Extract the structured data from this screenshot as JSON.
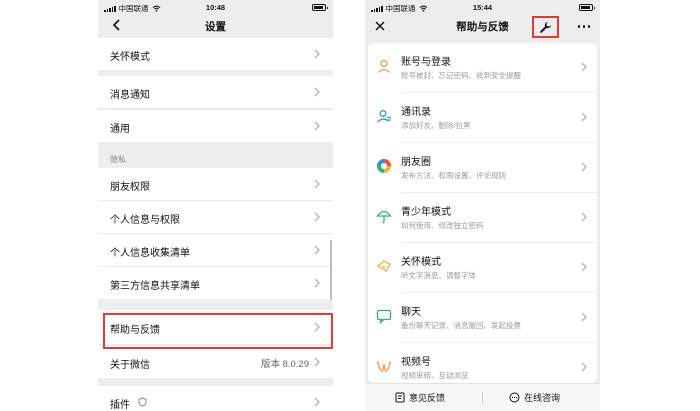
{
  "status": {
    "carrier": "中国联通",
    "time_left": "10:48",
    "time_right": "15:44"
  },
  "settings": {
    "title": "设置",
    "care_mode": "关怀模式",
    "notifications": "消息通知",
    "general": "通用",
    "privacy_section": "隐私",
    "moments_permission": "朋友权限",
    "personal_info": "个人信息与权限",
    "personal_info_list": "个人信息收集清单",
    "third_party_list": "第三方信息共享清单",
    "help_feedback": "帮助与反馈",
    "about": "关于微信",
    "version": "版本 8.0.29",
    "plugins": "插件"
  },
  "help": {
    "title": "帮助与反馈",
    "items": [
      {
        "title": "账号与登录",
        "desc": "账号被封、忘记密码、收到安全提醒",
        "icon": "person-icon",
        "color": "#f0a04b"
      },
      {
        "title": "通讯录",
        "desc": "添加好友、删除/拉黑",
        "icon": "contacts-icon",
        "color": "#3b8fd6"
      },
      {
        "title": "朋友圈",
        "desc": "发布方法、权限设置、评论规则",
        "icon": "moments-icon",
        "color": "#e8573f"
      },
      {
        "title": "青少年模式",
        "desc": "如何使用、修改独立密码",
        "icon": "umbrella-icon",
        "color": "#2bb673"
      },
      {
        "title": "关怀模式",
        "desc": "听文字消息、调整字体",
        "icon": "care-icon",
        "color": "#f0b43c"
      },
      {
        "title": "聊天",
        "desc": "备份聊天记录、消息撤回、发起投票",
        "icon": "chat-icon",
        "color": "#2bb673"
      },
      {
        "title": "视频号",
        "desc": "视频审核、互动浏览",
        "icon": "channels-icon",
        "color": "#f0a04b"
      }
    ],
    "feedback": "意见反馈",
    "online_consult": "在线咨询"
  },
  "colors": {
    "highlight": "#e53935",
    "background": "#ededed"
  }
}
